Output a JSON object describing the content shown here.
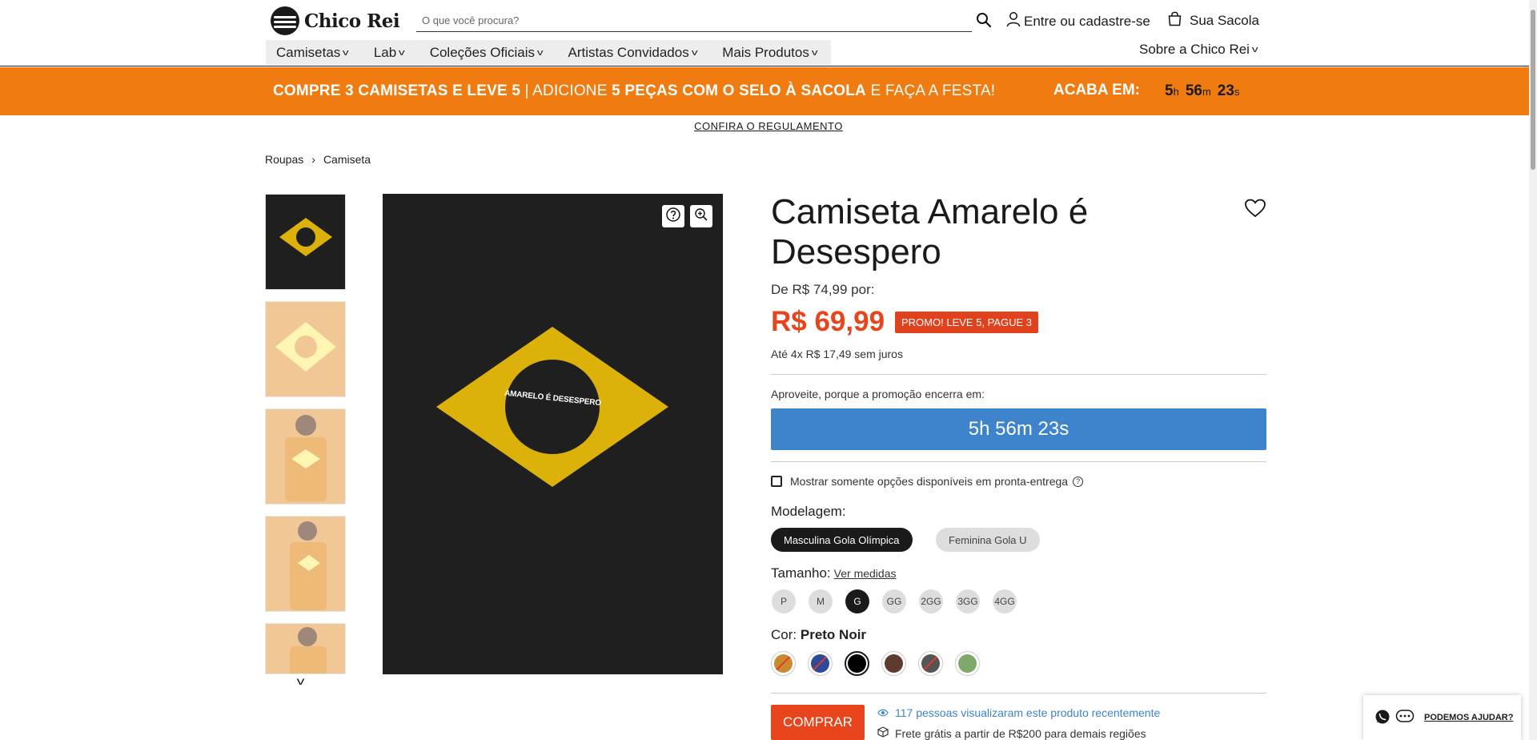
{
  "header": {
    "logo_text": "Chico Rei",
    "search_placeholder": "O que você procura?",
    "login_label": "Entre ou cadastre-se",
    "bag_label": "Sua Sacola"
  },
  "nav": {
    "items": [
      "Camisetas",
      "Lab",
      "Coleções Oficiais",
      "Artistas Convidados",
      "Mais Produtos"
    ],
    "about": "Sobre a Chico Rei"
  },
  "promo": {
    "part1": "COMPRE 3 CAMISETAS E LEVE 5",
    "sep": " | ",
    "part2": "ADICIONE ",
    "part3": "5 PEÇAS COM O SELO À SACOLA",
    "part4": " E FAÇA A FESTA!",
    "ends_label": "ACABA EM:",
    "hours": "5",
    "hours_unit": "h",
    "minutes": "56",
    "minutes_unit": "m",
    "seconds": "23",
    "seconds_unit": "s",
    "rules_link": "CONFIRA O REGULAMENTO"
  },
  "breadcrumb": {
    "items": [
      "Roupas",
      "Camiseta"
    ],
    "separator": "›"
  },
  "product": {
    "title": "Camiseta Amarelo é Desespero",
    "image_text": "AMARELO É DESESPERO",
    "old_price": "De R$ 74,99 por:",
    "price": "R$ 69,99",
    "promo_badge": "PROMO! LEVE 5, PAGUE 3",
    "installments": "Até 4x R$ 17,49 sem juros",
    "hurry_text": "Aproveite, porque a promoção encerra em:",
    "countdown": "5h 56m 23s",
    "ready_label": "Mostrar somente opções disponíveis em pronta-entrega",
    "fit_label": "Modelagem:",
    "fits": [
      "Masculina Gola Olímpica",
      "Feminina Gola U"
    ],
    "selected_fit": "Masculina Gola Olímpica",
    "size_label": "Tamanho:",
    "measures_link": "Ver medidas",
    "sizes": [
      "P",
      "M",
      "G",
      "GG",
      "2GG",
      "3GG",
      "4GG"
    ],
    "selected_size": "G",
    "color_label": "Cor:",
    "selected_color": "Preto Noir",
    "colors": [
      {
        "hex": "#c98b2e",
        "unavailable": true
      },
      {
        "hex": "#2d4a9a",
        "unavailable": true
      },
      {
        "hex": "#000000",
        "unavailable": false
      },
      {
        "hex": "#5e3a2f",
        "unavailable": false
      },
      {
        "hex": "#555555",
        "unavailable": true
      },
      {
        "hex": "#7fa96a",
        "unavailable": false
      }
    ],
    "buy_label": "COMPRAR",
    "viewers_text": "117 pessoas visualizaram este produto recentemente",
    "shipping_text": "Frete grátis a partir de R$200 para demais regiões"
  },
  "help": {
    "label": "PODEMOS AJUDAR?"
  },
  "colors": {
    "accent": "#e8451c",
    "banner": "#f07c11",
    "countdown": "#3e84cc",
    "flag_yellow": "#dcb20a"
  }
}
